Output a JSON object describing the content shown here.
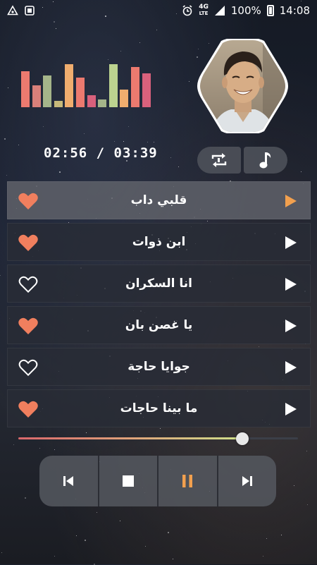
{
  "status_bar": {
    "lte_top": "4G",
    "lte_bottom": "LTE",
    "battery": "100%",
    "clock": "14:08"
  },
  "equalizer": {
    "levels": [
      0.82,
      0.5,
      0.72,
      0.15,
      0.98,
      0.68,
      0.28,
      0.18,
      0.98,
      0.4,
      0.92,
      0.78
    ],
    "colors": [
      "#ec7a6f",
      "#d9807a",
      "#a5b58a",
      "#c7b97a",
      "#f0ad6e",
      "#ec7a6f",
      "#d9617c",
      "#a5b58a",
      "#bcd38f",
      "#f0ad6e",
      "#ec7a6f",
      "#d9617c"
    ]
  },
  "player": {
    "elapsed_total": "02:56 / 03:39",
    "progress": 0.8
  },
  "songs": [
    {
      "title": "قلبي داب",
      "favorite": true,
      "active": true
    },
    {
      "title": "ابن ذوات",
      "favorite": true,
      "active": false
    },
    {
      "title": "انا السكران",
      "favorite": false,
      "active": false
    },
    {
      "title": "يا غصن بان",
      "favorite": true,
      "active": false
    },
    {
      "title": "جوايا حاجة",
      "favorite": false,
      "active": false
    },
    {
      "title": "ما بينا حاجات",
      "favorite": true,
      "active": false
    }
  ],
  "colors": {
    "accent": "#f2a04e",
    "heart": "#f07f5e",
    "white": "#ffffff"
  }
}
